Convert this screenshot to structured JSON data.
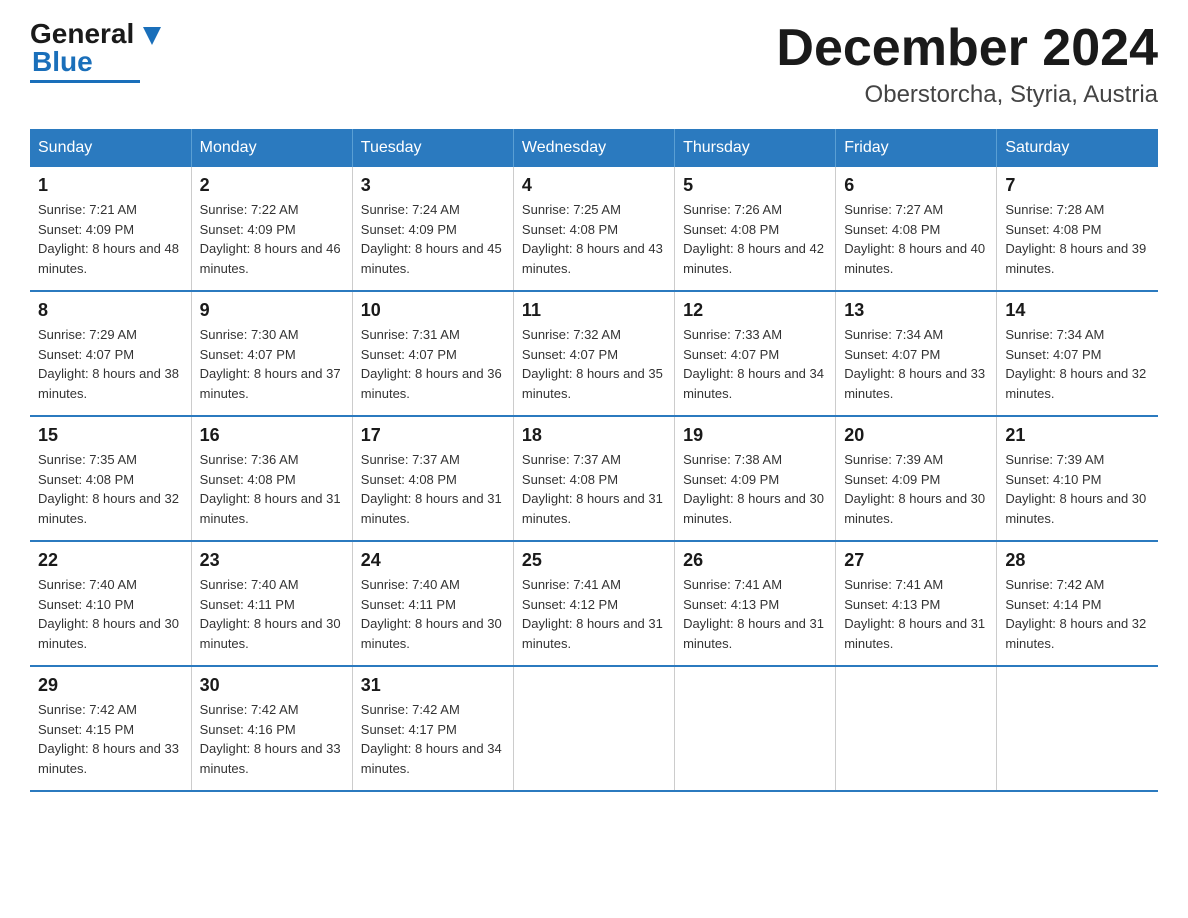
{
  "logo": {
    "general": "General",
    "blue": "Blue"
  },
  "title": "December 2024",
  "subtitle": "Oberstorcha, Styria, Austria",
  "days_of_week": [
    "Sunday",
    "Monday",
    "Tuesday",
    "Wednesday",
    "Thursday",
    "Friday",
    "Saturday"
  ],
  "weeks": [
    [
      {
        "day": "1",
        "sunrise": "7:21 AM",
        "sunset": "4:09 PM",
        "daylight": "8 hours and 48 minutes."
      },
      {
        "day": "2",
        "sunrise": "7:22 AM",
        "sunset": "4:09 PM",
        "daylight": "8 hours and 46 minutes."
      },
      {
        "day": "3",
        "sunrise": "7:24 AM",
        "sunset": "4:09 PM",
        "daylight": "8 hours and 45 minutes."
      },
      {
        "day": "4",
        "sunrise": "7:25 AM",
        "sunset": "4:08 PM",
        "daylight": "8 hours and 43 minutes."
      },
      {
        "day": "5",
        "sunrise": "7:26 AM",
        "sunset": "4:08 PM",
        "daylight": "8 hours and 42 minutes."
      },
      {
        "day": "6",
        "sunrise": "7:27 AM",
        "sunset": "4:08 PM",
        "daylight": "8 hours and 40 minutes."
      },
      {
        "day": "7",
        "sunrise": "7:28 AM",
        "sunset": "4:08 PM",
        "daylight": "8 hours and 39 minutes."
      }
    ],
    [
      {
        "day": "8",
        "sunrise": "7:29 AM",
        "sunset": "4:07 PM",
        "daylight": "8 hours and 38 minutes."
      },
      {
        "day": "9",
        "sunrise": "7:30 AM",
        "sunset": "4:07 PM",
        "daylight": "8 hours and 37 minutes."
      },
      {
        "day": "10",
        "sunrise": "7:31 AM",
        "sunset": "4:07 PM",
        "daylight": "8 hours and 36 minutes."
      },
      {
        "day": "11",
        "sunrise": "7:32 AM",
        "sunset": "4:07 PM",
        "daylight": "8 hours and 35 minutes."
      },
      {
        "day": "12",
        "sunrise": "7:33 AM",
        "sunset": "4:07 PM",
        "daylight": "8 hours and 34 minutes."
      },
      {
        "day": "13",
        "sunrise": "7:34 AM",
        "sunset": "4:07 PM",
        "daylight": "8 hours and 33 minutes."
      },
      {
        "day": "14",
        "sunrise": "7:34 AM",
        "sunset": "4:07 PM",
        "daylight": "8 hours and 32 minutes."
      }
    ],
    [
      {
        "day": "15",
        "sunrise": "7:35 AM",
        "sunset": "4:08 PM",
        "daylight": "8 hours and 32 minutes."
      },
      {
        "day": "16",
        "sunrise": "7:36 AM",
        "sunset": "4:08 PM",
        "daylight": "8 hours and 31 minutes."
      },
      {
        "day": "17",
        "sunrise": "7:37 AM",
        "sunset": "4:08 PM",
        "daylight": "8 hours and 31 minutes."
      },
      {
        "day": "18",
        "sunrise": "7:37 AM",
        "sunset": "4:08 PM",
        "daylight": "8 hours and 31 minutes."
      },
      {
        "day": "19",
        "sunrise": "7:38 AM",
        "sunset": "4:09 PM",
        "daylight": "8 hours and 30 minutes."
      },
      {
        "day": "20",
        "sunrise": "7:39 AM",
        "sunset": "4:09 PM",
        "daylight": "8 hours and 30 minutes."
      },
      {
        "day": "21",
        "sunrise": "7:39 AM",
        "sunset": "4:10 PM",
        "daylight": "8 hours and 30 minutes."
      }
    ],
    [
      {
        "day": "22",
        "sunrise": "7:40 AM",
        "sunset": "4:10 PM",
        "daylight": "8 hours and 30 minutes."
      },
      {
        "day": "23",
        "sunrise": "7:40 AM",
        "sunset": "4:11 PM",
        "daylight": "8 hours and 30 minutes."
      },
      {
        "day": "24",
        "sunrise": "7:40 AM",
        "sunset": "4:11 PM",
        "daylight": "8 hours and 30 minutes."
      },
      {
        "day": "25",
        "sunrise": "7:41 AM",
        "sunset": "4:12 PM",
        "daylight": "8 hours and 31 minutes."
      },
      {
        "day": "26",
        "sunrise": "7:41 AM",
        "sunset": "4:13 PM",
        "daylight": "8 hours and 31 minutes."
      },
      {
        "day": "27",
        "sunrise": "7:41 AM",
        "sunset": "4:13 PM",
        "daylight": "8 hours and 31 minutes."
      },
      {
        "day": "28",
        "sunrise": "7:42 AM",
        "sunset": "4:14 PM",
        "daylight": "8 hours and 32 minutes."
      }
    ],
    [
      {
        "day": "29",
        "sunrise": "7:42 AM",
        "sunset": "4:15 PM",
        "daylight": "8 hours and 33 minutes."
      },
      {
        "day": "30",
        "sunrise": "7:42 AM",
        "sunset": "4:16 PM",
        "daylight": "8 hours and 33 minutes."
      },
      {
        "day": "31",
        "sunrise": "7:42 AM",
        "sunset": "4:17 PM",
        "daylight": "8 hours and 34 minutes."
      },
      null,
      null,
      null,
      null
    ]
  ]
}
